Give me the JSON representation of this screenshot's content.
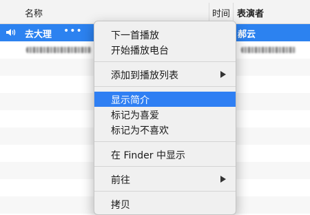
{
  "columns": {
    "name": "名称",
    "time": "时间",
    "artist": "表演者"
  },
  "selected_row": {
    "title": "去大理",
    "dots": "•••",
    "artist": "郝云"
  },
  "context_menu": {
    "items": [
      "下一首播放",
      "开始播放电台",
      "添加到播放列表",
      "显示简介",
      "标记为喜爱",
      "标记为不喜欢",
      "在 Finder 中显示",
      "前往",
      "拷贝"
    ],
    "highlighted": "显示简介"
  },
  "colors": {
    "selection": "#2c82f0",
    "menu_highlight": "#2f7ff3"
  },
  "icons": {
    "speaker": "speaker-icon",
    "submenu": "chevron-right-icon"
  }
}
